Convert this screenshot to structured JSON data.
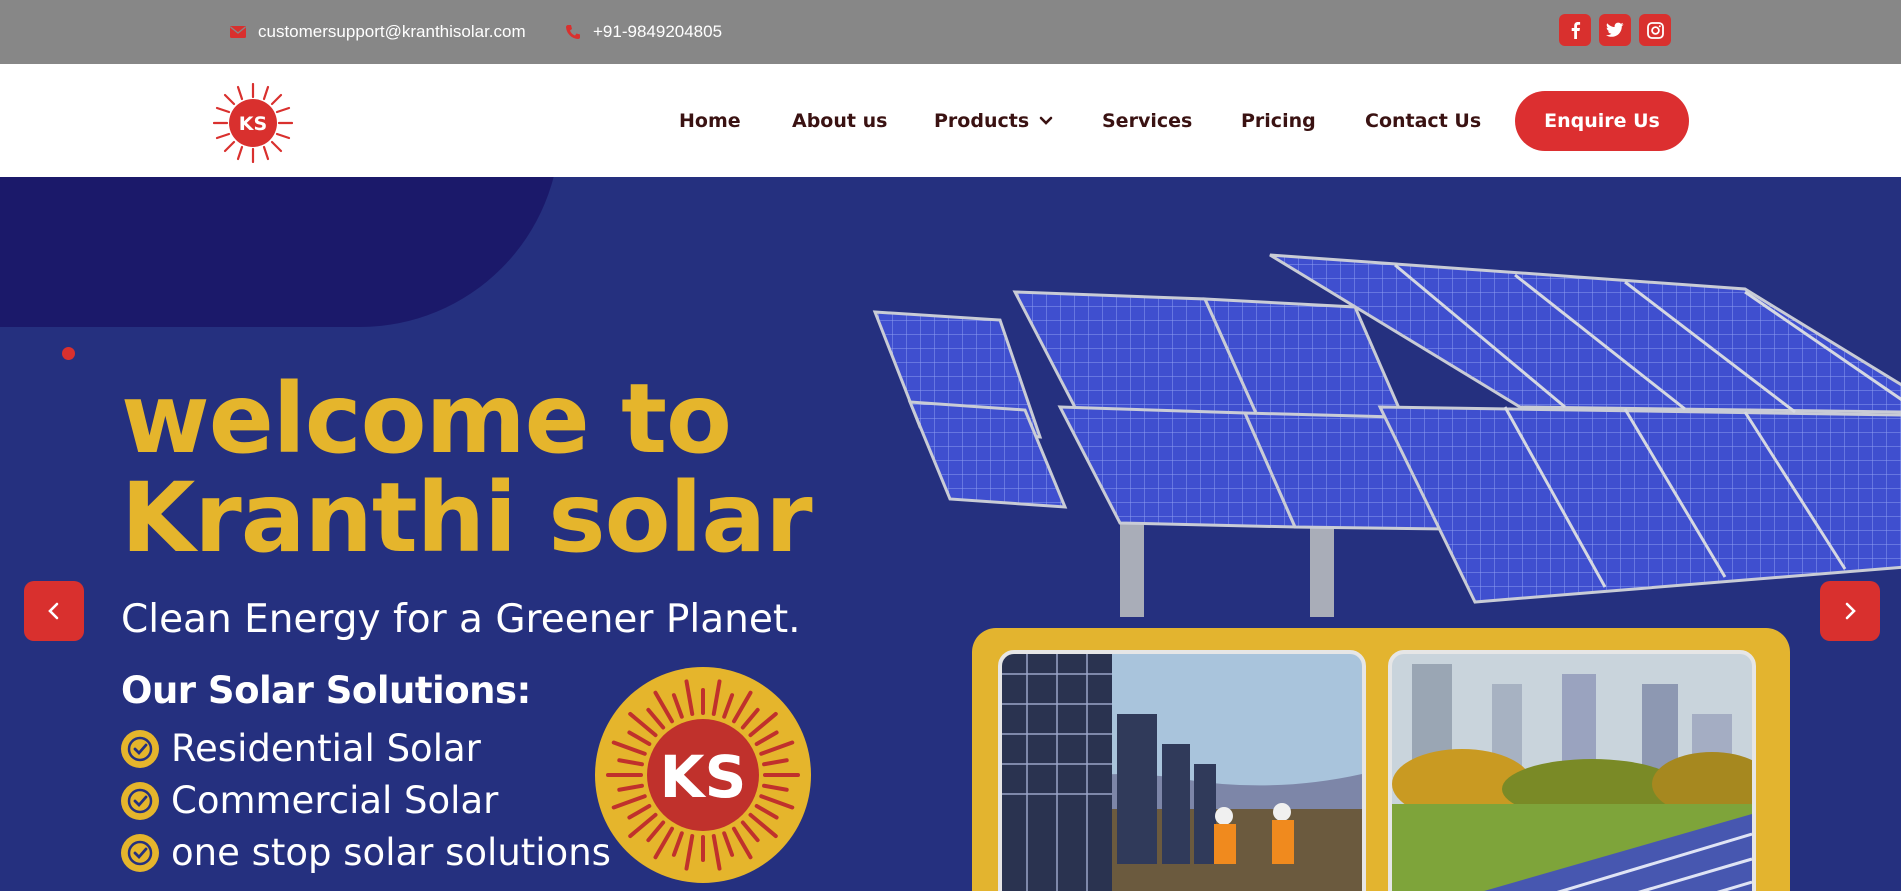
{
  "topbar": {
    "email": "customersupport@kranthisolar.com",
    "phone": "+91-9849204805",
    "social": [
      {
        "icon": "facebook-icon"
      },
      {
        "icon": "twitter-icon"
      },
      {
        "icon": "instagram-icon"
      }
    ]
  },
  "nav": {
    "logo_text": "KS",
    "items": [
      {
        "label": "Home"
      },
      {
        "label": "About us"
      },
      {
        "label": "Products"
      },
      {
        "label": "Services"
      },
      {
        "label": "Pricing"
      },
      {
        "label": "Contact Us"
      }
    ],
    "cta": "Enquire Us"
  },
  "hero": {
    "title_line1": "welcome to",
    "title_line2": "Kranthi solar",
    "subtitle": "Clean Energy for a Greener Planet.",
    "solutions_heading": "Our Solar Solutions:",
    "solutions": [
      "Residential Solar",
      "Commercial Solar",
      "one stop solar solutions"
    ],
    "badge_text": "KS"
  },
  "colors": {
    "brand_red": "#d9302e",
    "brand_yellow": "#e5b52c",
    "hero_blue": "#25307f",
    "topbar_gray": "#878787"
  }
}
